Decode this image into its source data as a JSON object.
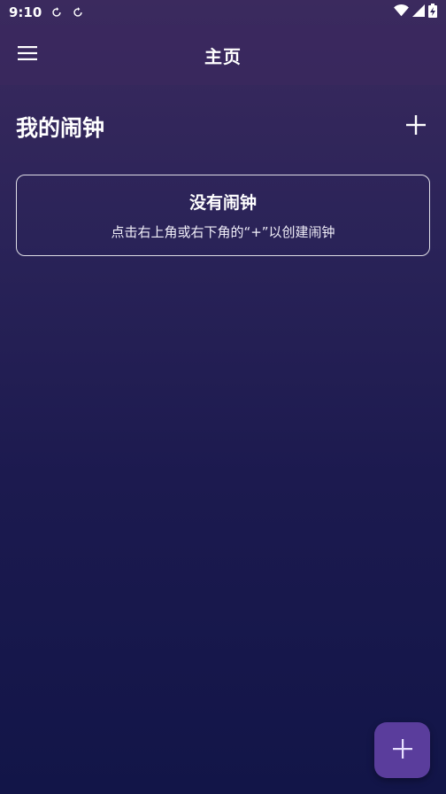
{
  "status_bar": {
    "time": "9:10",
    "icons": [
      "sync-icon",
      "sync-icon",
      "wifi-icon",
      "signal-icon",
      "battery-charging-icon"
    ]
  },
  "app_bar": {
    "title": "主页",
    "menu_icon": "hamburger-menu-icon"
  },
  "section": {
    "title": "我的闹钟",
    "add_icon": "plus-icon"
  },
  "empty_state": {
    "title": "没有闹钟",
    "hint": "点击右上角或右下角的“+”以创建闹钟"
  },
  "fab": {
    "icon": "plus-icon"
  },
  "colors": {
    "fab_background": "#5a3d9c",
    "background_top": "#3b2a5e",
    "background_bottom": "#121548",
    "text": "#ffffff"
  }
}
